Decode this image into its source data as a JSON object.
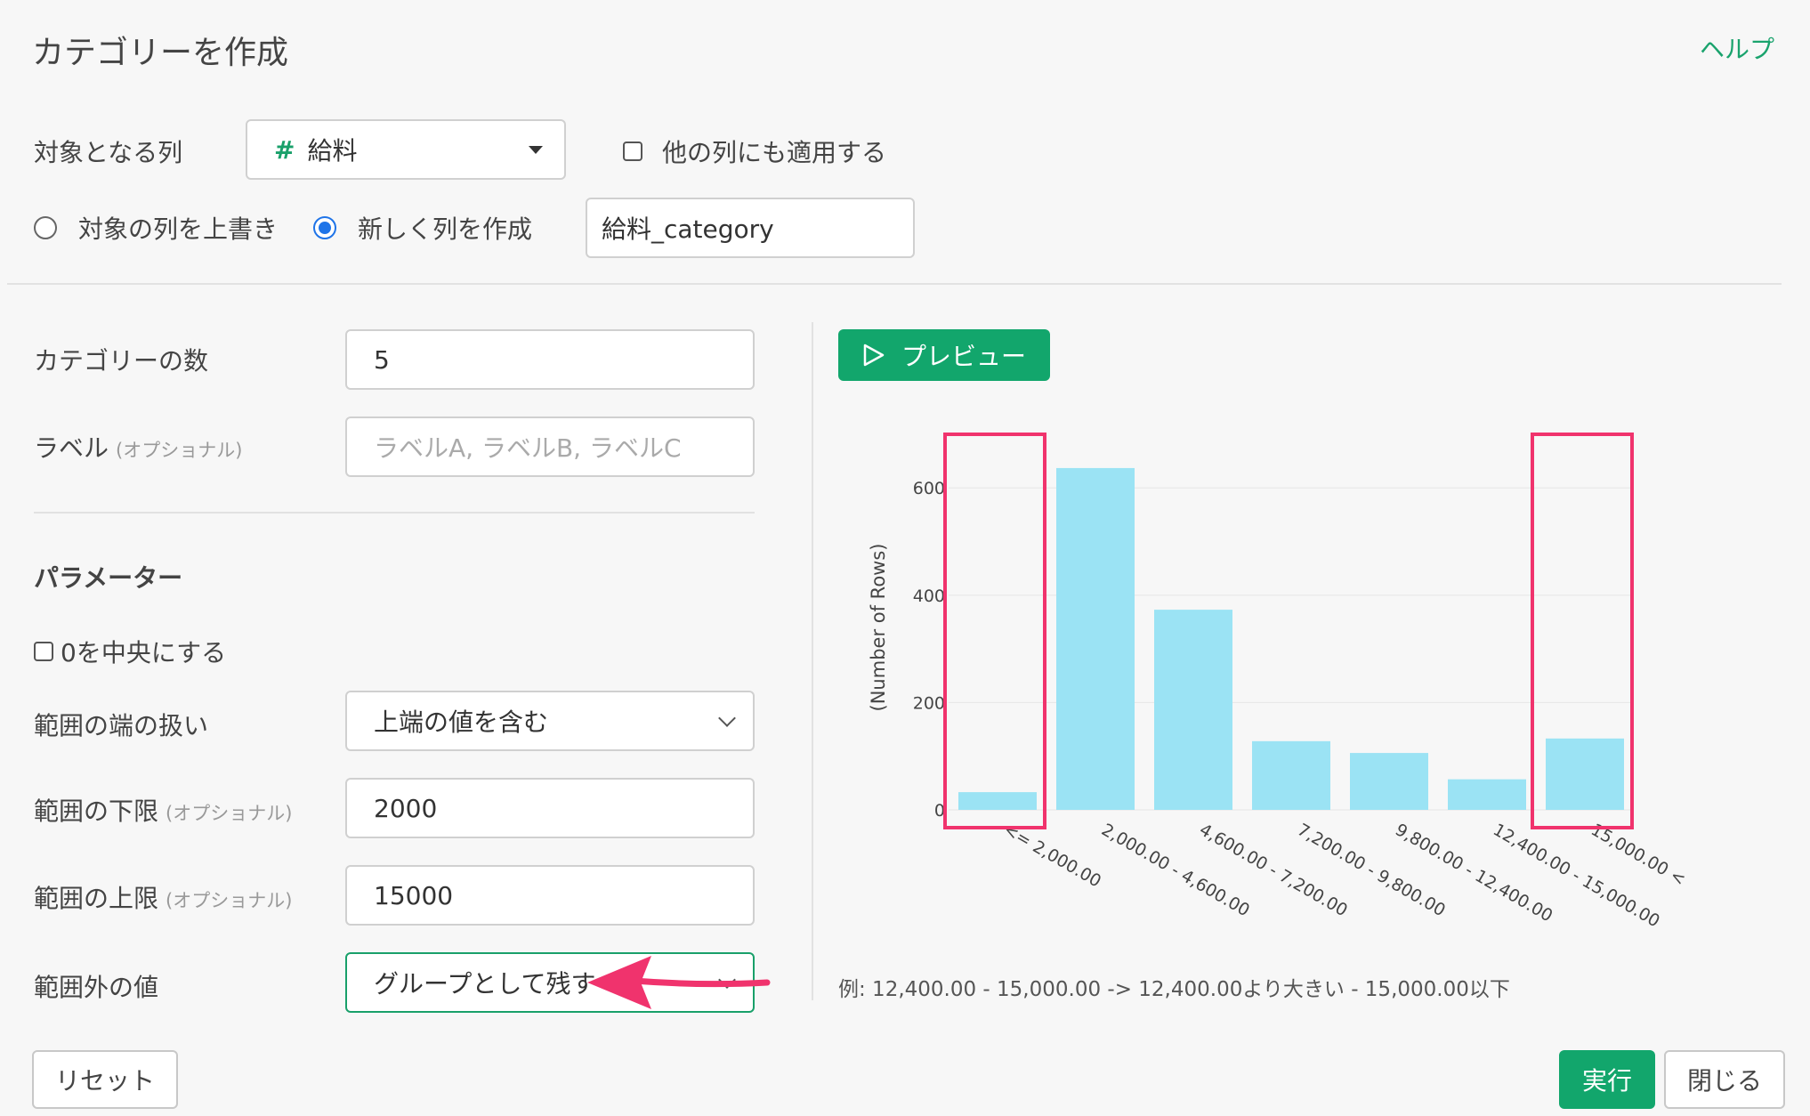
{
  "header": {
    "title": "カテゴリーを作成",
    "help_label": "ヘルプ"
  },
  "target": {
    "label": "対象となる列",
    "column_type_glyph": "#",
    "column_value": "給料",
    "apply_other_label": "他の列にも適用する",
    "overwrite_label": "対象の列を上書き",
    "create_new_label": "新しく列を作成",
    "selected_mode": "create_new",
    "new_column_name": "給料_category"
  },
  "settings": {
    "num_categories_label": "カテゴリーの数",
    "num_categories_value": "5",
    "label_label": "ラベル",
    "optional_note": "(オプショナル)",
    "label_placeholder": "ラベルA, ラベルB, ラベルC"
  },
  "parameters": {
    "heading": "パラメーター",
    "center_zero_label": "0を中央にする",
    "edge_label": "範囲の端の扱い",
    "edge_value": "上端の値を含む",
    "lower_label": "範囲の下限",
    "lower_value": "2000",
    "upper_label": "範囲の上限",
    "upper_value": "15000",
    "outside_label": "範囲外の値",
    "outside_value": "グループとして残す"
  },
  "preview": {
    "button_label": "プレビュー",
    "example_text": "例: 12,400.00 - 15,000.00 -> 12,400.00より大きい - 15,000.00以下"
  },
  "footer": {
    "reset_label": "リセット",
    "run_label": "実行",
    "close_label": "閉じる"
  },
  "colors": {
    "accent": "#12a66c",
    "bar": "#9be3f4",
    "highlight": "#f0336d"
  },
  "chart_data": {
    "type": "bar",
    "ylabel": "(Number of Rows)",
    "categories": [
      "<= 2,000.00",
      "2,000.00 - 4,600.00",
      "4,600.00 - 7,200.00",
      "7,200.00 - 9,800.00",
      "9,800.00 - 12,400.00",
      "12,400.00 - 15,000.00",
      "15,000.00 <"
    ],
    "values": [
      33,
      637,
      373,
      128,
      106,
      57,
      133
    ],
    "yticks": [
      0,
      200,
      400,
      600
    ],
    "ylim": [
      0,
      680
    ],
    "grid": true,
    "highlighted": [
      "<= 2,000.00",
      "15,000.00 <"
    ]
  }
}
